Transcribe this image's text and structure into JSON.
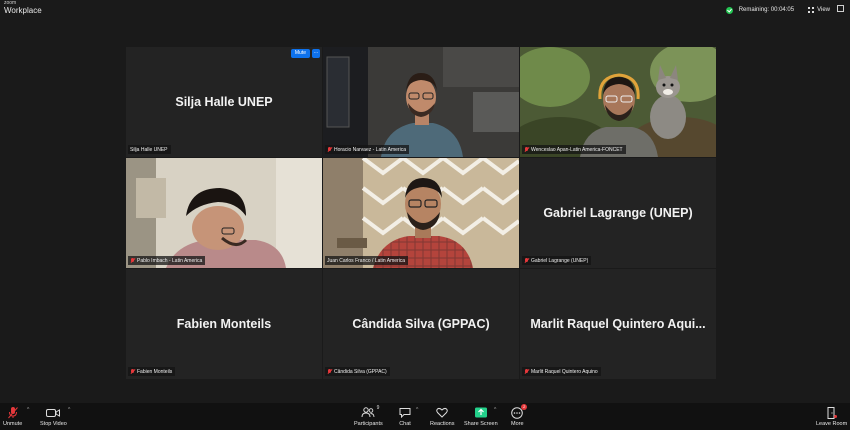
{
  "app": {
    "brand_small": "zoom",
    "brand_product": "Workplace"
  },
  "header": {
    "remaining": "Remaining: 00:04:05",
    "view_label": "View"
  },
  "tiles": [
    {
      "big_name": "Silja Halle UNEP",
      "label": "Silja Halle UNEP",
      "mute_button": "Mute",
      "more_button": "...",
      "muted": false
    },
    {
      "big_name": "",
      "label": "Horacio Narvaez - Latin America",
      "muted": true
    },
    {
      "big_name": "",
      "label": "Wenceslao Apan-Latin America-FONCET",
      "muted": true
    },
    {
      "big_name": "",
      "label": "Pablo Imbach - Latin America",
      "muted": true
    },
    {
      "big_name": "",
      "label": "Juan Carlos Franco / Latin America",
      "muted": false
    },
    {
      "big_name": "Gabriel Lagrange (UNEP)",
      "label": "Gabriel Lagrange (UNEP)",
      "muted": true
    },
    {
      "big_name": "Fabien Monteils",
      "label": "Fabien Monteils",
      "muted": true
    },
    {
      "big_name": "Cândida Silva (GPPAC)",
      "label": "Cândida Silva (GPPAC)",
      "muted": true
    },
    {
      "big_name": "Marlit Raquel Quintero Aqui...",
      "label": "Marlit Raquel Quintero Aquino",
      "muted": true
    }
  ],
  "toolbar": {
    "unmute": "Unmute",
    "stop_video": "Stop Video",
    "participants": "Participants",
    "participants_count": "9",
    "chat": "Chat",
    "reactions": "Reactions",
    "share_screen": "Share Screen",
    "more": "More",
    "more_badge": "2",
    "leave_room": "Leave Room"
  },
  "colors": {
    "accent_blue": "#0e72ed",
    "share_green": "#23d18b",
    "muted_red": "#e5383b",
    "encrypted_green": "#23c552",
    "active_speaker": "#d8d86b"
  }
}
